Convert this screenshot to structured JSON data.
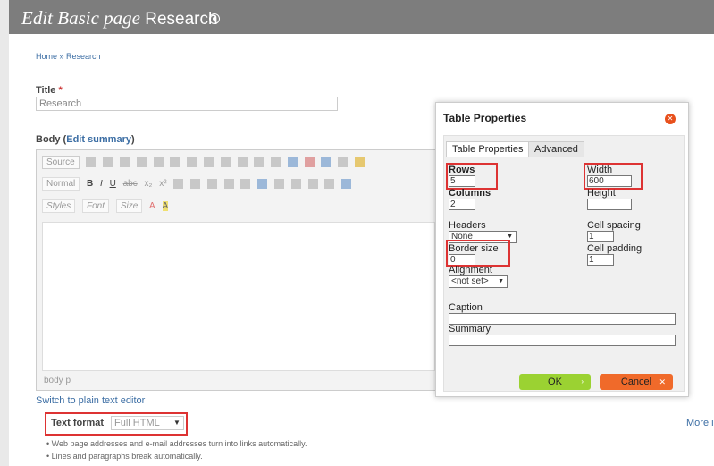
{
  "header": {
    "title_italic": "Edit Basic page",
    "title_name": "Research"
  },
  "breadcrumb": "Home » Research",
  "title_field": {
    "label": "Title",
    "required": "*",
    "value": "Research"
  },
  "body_field": {
    "label": "Body",
    "edit_summary": "Edit summary"
  },
  "toolbar": {
    "source": "Source",
    "format": "Normal",
    "bold": "B",
    "italic": "I",
    "underline": "U",
    "strike": "abc",
    "subscript": "x₂",
    "superscript": "x²",
    "styles": "Styles",
    "font": "Font",
    "size": "Size",
    "text_color": "A",
    "bg_color": "A"
  },
  "editor_path": "body  p",
  "switch_link": "Switch to plain text editor",
  "text_format": {
    "label": "Text format",
    "value": "Full HTML"
  },
  "more_link": "More i",
  "tips": [
    "Web page addresses and e-mail addresses turn into links automatically.",
    "Lines and paragraphs break automatically."
  ],
  "dialog": {
    "title": "Table Properties",
    "tabs": [
      "Table Properties",
      "Advanced"
    ],
    "rows_label": "Rows",
    "rows_value": "5",
    "columns_label": "Columns",
    "columns_value": "2",
    "width_label": "Width",
    "width_value": "600",
    "height_label": "Height",
    "height_value": "",
    "headers_label": "Headers",
    "headers_value": "None",
    "cell_spacing_label": "Cell spacing",
    "cell_spacing_value": "1",
    "border_size_label": "Border size",
    "border_size_value": "0",
    "cell_padding_label": "Cell padding",
    "cell_padding_value": "1",
    "alignment_label": "Alignment",
    "alignment_value": "<not set>",
    "caption_label": "Caption",
    "caption_value": "",
    "summary_label": "Summary",
    "summary_value": "",
    "ok_label": "OK",
    "cancel_label": "Cancel"
  },
  "colors": {
    "header": "#7d7d7d",
    "link": "#3c6ea4",
    "highlight": "#dd3333",
    "ok": "#9bd232",
    "cancel": "#f06a2a"
  }
}
